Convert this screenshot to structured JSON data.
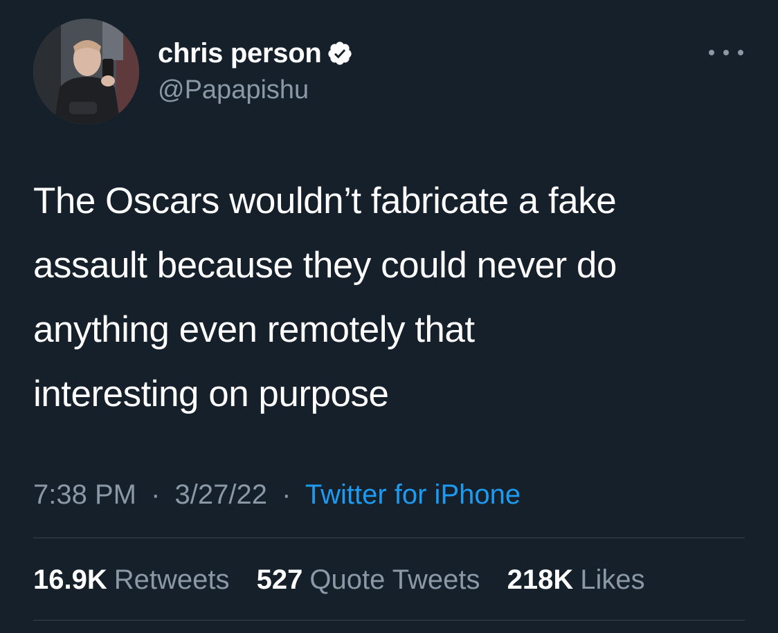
{
  "author": {
    "display_name": "chris person",
    "handle": "@Papapishu",
    "verified": true,
    "avatar_icon": "profile-photo"
  },
  "tweet": {
    "text": "The Oscars wouldn’t fabricate a fake\nassault because they could never do\nanything even remotely that\ninteresting on purpose",
    "time": "7:38 PM",
    "date": "3/27/22",
    "separator": "·",
    "source": "Twitter for iPhone"
  },
  "stats": {
    "retweets": {
      "count": "16.9K",
      "label": "Retweets"
    },
    "quote_tweets": {
      "count": "527",
      "label": "Quote Tweets"
    },
    "likes": {
      "count": "218K",
      "label": "Likes"
    }
  },
  "colors": {
    "background": "#15202b",
    "text": "#ffffff",
    "secondary": "#8b98a5",
    "link": "#1d9bf0",
    "divider": "#38444d"
  },
  "icons": {
    "verified": "verified-badge-icon",
    "more": "more-options-icon"
  }
}
